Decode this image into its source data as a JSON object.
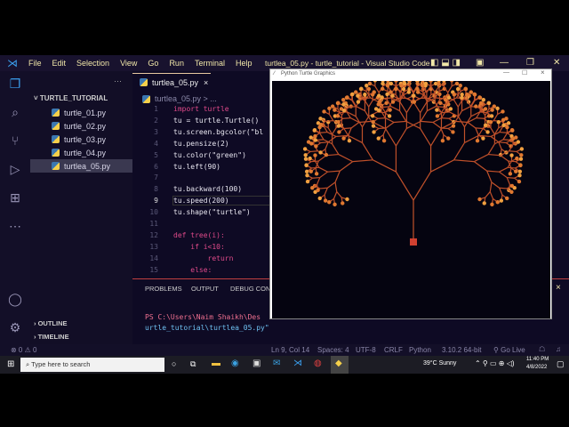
{
  "window": {
    "title": "turtlea_05.py - turtle_tutorial - Visual Studio Code"
  },
  "menu": [
    "File",
    "Edit",
    "Selection",
    "View",
    "Go",
    "Run",
    "Terminal",
    "Help"
  ],
  "sidebar": {
    "more": "···",
    "folder": "TURTLE_TUTORIAL",
    "files": [
      "turtle_01.py",
      "turtle_02.py",
      "turtle_03.py",
      "turtle_04.py",
      "turtlea_05.py"
    ],
    "outline": "OUTLINE",
    "timeline": "TIMELINE"
  },
  "editor": {
    "tab": "turtlea_05.py",
    "tab_close": "×",
    "breadcrumb": "turtlea_05.py > ...",
    "lines": [
      {
        "n": "1",
        "t": "import turtle"
      },
      {
        "n": "2",
        "t": "tu = turtle.Turtle()"
      },
      {
        "n": "3",
        "t": "tu.screen.bgcolor(\"bl"
      },
      {
        "n": "4",
        "t": "tu.pensize(2)"
      },
      {
        "n": "5",
        "t": "tu.color(\"green\")"
      },
      {
        "n": "6",
        "t": "tu.left(90)"
      },
      {
        "n": "7",
        "t": ""
      },
      {
        "n": "8",
        "t": "tu.backward(100)"
      },
      {
        "n": "9",
        "t": "tu.speed(200)"
      },
      {
        "n": "10",
        "t": "tu.shape(\"turtle\")"
      },
      {
        "n": "11",
        "t": ""
      },
      {
        "n": "12",
        "t": "def tree(i):"
      },
      {
        "n": "13",
        "t": "    if i<10:"
      },
      {
        "n": "14",
        "t": "        return"
      },
      {
        "n": "15",
        "t": "    else:"
      }
    ]
  },
  "panel": {
    "tabs": [
      "PROBLEMS",
      "OUTPUT",
      "DEBUG CONS"
    ],
    "close": "×",
    "terminal": [
      "PS C:\\Users\\Naim Shaikh\\Des",
      "urtle_tutorial\\turtlea_05.py\""
    ]
  },
  "turtle_window": {
    "title": "Python Turtle Graphics",
    "min": "—",
    "max": "☐",
    "close": "×"
  },
  "status": {
    "errors": "⊗ 0 ⚠ 0",
    "position": "Ln 9, Col 14",
    "spaces": "Spaces: 4",
    "encoding": "UTF-8",
    "eol": "CRLF",
    "language": "Python",
    "version": "3.10.2 64-bit",
    "golive": "Go Live"
  },
  "taskbar": {
    "search": "Type here to search",
    "weather": "39°C  Sunny",
    "time": "11:40 PM",
    "date": "4/8/2022"
  }
}
